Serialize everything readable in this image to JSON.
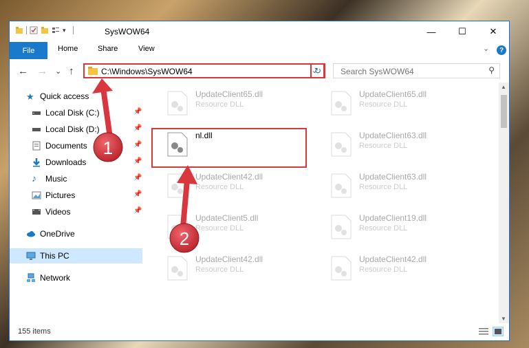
{
  "window": {
    "title": "SysWOW64",
    "minimize_label": "—",
    "maximize_label": "☐",
    "close_label": "✕"
  },
  "ribbon": {
    "tabs": [
      "File",
      "Home",
      "Share",
      "View"
    ],
    "expand_glyph": "⌄",
    "help_glyph": "?"
  },
  "navigation": {
    "back_glyph": "←",
    "forward_glyph": "→",
    "recent_glyph": "⌄",
    "up_glyph": "↑",
    "address": "C:\\Windows\\SysWOW64",
    "address_dropdown_glyph": "⌄",
    "refresh_glyph": "↻",
    "search_placeholder": "Search SysWOW64",
    "search_glyph": "⚲"
  },
  "sidebar": {
    "items": [
      {
        "label": "Quick access",
        "icon": "star-icon",
        "pinned": false
      },
      {
        "label": "Local Disk (C:)",
        "icon": "drive-icon",
        "pinned": true
      },
      {
        "label": "Local Disk (D:)",
        "icon": "drive-icon",
        "pinned": true
      },
      {
        "label": "Documents",
        "icon": "documents-icon",
        "pinned": true
      },
      {
        "label": "Downloads",
        "icon": "download-icon",
        "pinned": true
      },
      {
        "label": "Music",
        "icon": "music-icon",
        "pinned": true
      },
      {
        "label": "Pictures",
        "icon": "pictures-icon",
        "pinned": true
      },
      {
        "label": "Videos",
        "icon": "videos-icon",
        "pinned": true
      },
      {
        "label": "OneDrive",
        "icon": "cloud-icon",
        "pinned": false
      },
      {
        "label": "This PC",
        "icon": "computer-icon",
        "pinned": false,
        "selected": true
      },
      {
        "label": "Network",
        "icon": "network-icon",
        "pinned": false
      }
    ],
    "pin_glyph": "📌"
  },
  "files": {
    "left": [
      {
        "name": "UpdateClient65.dll",
        "type": "Resource DLL"
      },
      {
        "name": "nl.dll",
        "type": ""
      },
      {
        "name": "UpdateClient42.dll",
        "type": "Resource DLL"
      },
      {
        "name": "UpdateClient5.dll",
        "type": "Resource DLL"
      },
      {
        "name": "UpdateClient42.dll",
        "type": "Resource DLL"
      }
    ],
    "right": [
      {
        "name": "UpdateClient65.dll",
        "type": "Resource DLL"
      },
      {
        "name": "UpdateClient63.dll",
        "type": "Resource DLL"
      },
      {
        "name": "UpdateClient63.dll",
        "type": "Resource DLL"
      },
      {
        "name": "UpdateClient19.dll",
        "type": "Resource DLL"
      },
      {
        "name": "UpdateClient42.dll",
        "type": "Resource DLL"
      }
    ]
  },
  "status": {
    "count": "155 items"
  },
  "annotations": {
    "step1": "1",
    "step2": "2"
  },
  "colors": {
    "accent": "#1979ca",
    "highlight": "#d9363e",
    "selection": "#cde8ff"
  }
}
